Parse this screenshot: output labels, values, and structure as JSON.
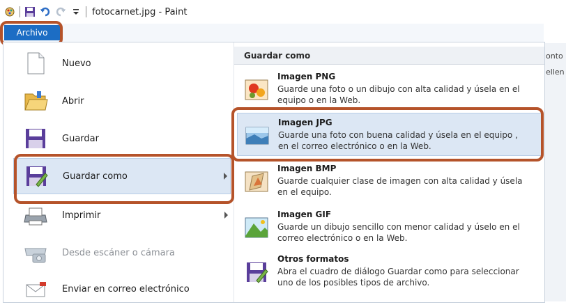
{
  "window": {
    "title": "fotocarnet.jpg - Paint",
    "tab_file": "Archivo"
  },
  "background_right": {
    "line1": "onto",
    "line2": "ellen"
  },
  "menu_left": [
    {
      "label": "Nuevo",
      "icon": "new-document-icon"
    },
    {
      "label": "Abrir",
      "icon": "open-folder-icon"
    },
    {
      "label": "Guardar",
      "icon": "save-icon"
    },
    {
      "label": "Guardar como",
      "icon": "save-as-icon",
      "selected": true,
      "submenu": true
    },
    {
      "label": "Imprimir",
      "icon": "printer-icon",
      "submenu": true
    },
    {
      "label": "Desde escáner o cámara",
      "icon": "scanner-icon",
      "disabled": true
    },
    {
      "label": "Enviar en correo electrónico",
      "icon": "email-icon"
    }
  ],
  "submenu": {
    "header": "Guardar como",
    "items": [
      {
        "title": "Imagen PNG",
        "desc": "Guarde una foto o un dibujo con alta calidad y úsela en el equipo o en la Web.",
        "icon": "png-image-icon"
      },
      {
        "title": "Imagen JPG",
        "desc": "Guarde una foto con buena calidad y úsela en el equipo , en el correo electrónico o en la Web.",
        "icon": "jpg-image-icon",
        "selected": true
      },
      {
        "title": "Imagen BMP",
        "desc": "Guarde cualquier clase de imagen con alta calidad y úsela en el equipo.",
        "icon": "bmp-image-icon"
      },
      {
        "title": "Imagen GIF",
        "desc": "Guarde un dibujo sencillo con menor calidad y úselo en el correo electrónico o en la Web.",
        "icon": "gif-image-icon"
      },
      {
        "title": "Otros formatos",
        "desc": "Abra el cuadro de diálogo Guardar como para seleccionar uno de los posibles tipos de archivo.",
        "icon": "other-formats-icon"
      }
    ]
  },
  "colors": {
    "accent_tab": "#1c6dc4",
    "highlight_outline": "#b5532a",
    "selection_bg": "#dce7f4"
  }
}
